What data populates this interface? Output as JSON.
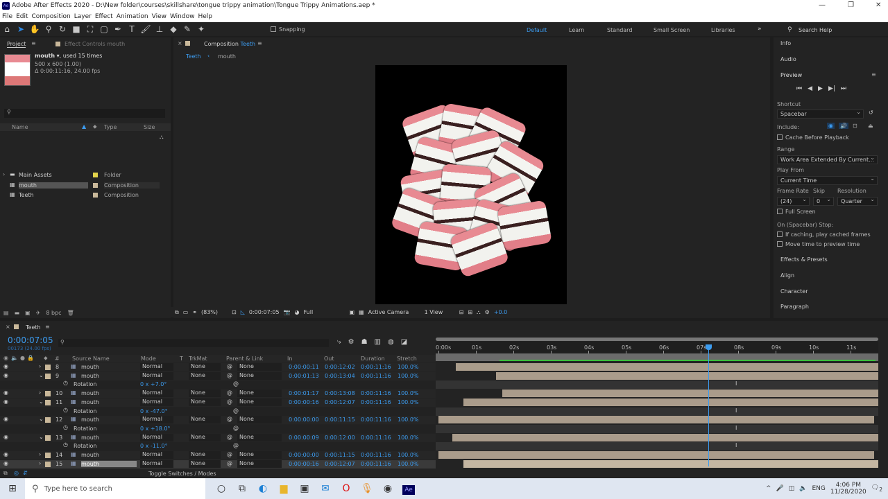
{
  "window": {
    "title": "Adobe After Effects 2020 - D:\\New folder\\courses\\skillshare\\tongue trippy animation\\Tongue Trippy Animations.aep *",
    "app_icon": "Ae"
  },
  "menu": [
    "File",
    "Edit",
    "Composition",
    "Layer",
    "Effect",
    "Animation",
    "View",
    "Window",
    "Help"
  ],
  "toolbar": {
    "snapping_label": "Snapping",
    "workspaces": [
      "Default",
      "Learn",
      "Standard",
      "Small Screen",
      "Libraries"
    ],
    "active_workspace": "Default",
    "search_placeholder": "Search Help"
  },
  "project": {
    "tab": "Project",
    "effect_controls_tab": "Effect Controls mouth",
    "item_name": "mouth",
    "item_used": ", used 15 times",
    "item_dims": "500 x 600 (1.00)",
    "item_duration": "Δ 0:00:11:16, 24.00 fps",
    "bpc": "8 bpc",
    "columns": [
      "Name",
      "Type",
      "Size"
    ],
    "items": [
      {
        "name": "Main Assets",
        "type": "Folder",
        "label_color": "#e3d34b",
        "icon": "folder-icon"
      },
      {
        "name": "mouth",
        "type": "Composition",
        "label_color": "#c9b89a",
        "icon": "composition-icon",
        "selected": true
      },
      {
        "name": "Teeth",
        "type": "Composition",
        "label_color": "#c9b89a",
        "icon": "composition-icon"
      }
    ]
  },
  "composition": {
    "tab_label": "Composition",
    "comp_name": "Teeth",
    "breadcrumb": [
      "Teeth",
      "mouth"
    ],
    "footer": {
      "zoom": "(83%)",
      "timecode": "0:00:07:05",
      "resolution": "Full",
      "camera": "Active Camera",
      "views": "1 View",
      "exposure": "+0.0"
    }
  },
  "preview": {
    "panels_top": [
      "Info",
      "Audio"
    ],
    "title": "Preview",
    "shortcut_label": "Shortcut",
    "shortcut": "Spacebar",
    "include_label": "Include:",
    "cache_label": "Cache Before Playback",
    "range_label": "Range",
    "range": "Work Area Extended By Current...",
    "play_from_label": "Play From",
    "play_from": "Current Time",
    "frame_rate_label": "Frame Rate",
    "frame_rate": "(24)",
    "skip_label": "Skip",
    "skip": "0",
    "resolution_label": "Resolution",
    "resolution": "Quarter",
    "full_screen_label": "Full Screen",
    "stop_label": "On (Spacebar) Stop:",
    "stop_opt1": "If caching, play cached frames",
    "stop_opt2": "Move time to preview time",
    "panels_bottom": [
      "Effects & Presets",
      "Align",
      "Character",
      "Paragraph"
    ]
  },
  "timeline": {
    "tab": "Teeth",
    "current_time": "0:00:07:05",
    "frame_info": "00173 (24.00 fps)",
    "toggle_label": "Toggle Switches / Modes",
    "accent": "#3c9cf0",
    "columns": [
      "Source Name",
      "Mode",
      "T",
      "TrkMat",
      "Parent & Link",
      "In",
      "Out",
      "Duration",
      "Stretch",
      "#"
    ],
    "ruler": [
      "0:00s",
      "01s",
      "02s",
      "03s",
      "04s",
      "05s",
      "06s",
      "07s",
      "08s",
      "09s",
      "10s",
      "11s"
    ],
    "current_seconds": 7.21,
    "rows": [
      {
        "kind": "layer",
        "num": "8",
        "name": "mouth",
        "mode": "Normal",
        "trkmat": "None",
        "parent": "None",
        "in": "0:00:00:11",
        "out": "0:00:12:02",
        "duration": "0:00:11:16",
        "stretch": "100.0%",
        "expanded": false
      },
      {
        "kind": "layer",
        "num": "9",
        "name": "mouth",
        "mode": "Normal",
        "trkmat": "None",
        "parent": "None",
        "in": "0:00:01:13",
        "out": "0:00:13:04",
        "duration": "0:00:11:16",
        "stretch": "100.0%",
        "expanded": true
      },
      {
        "kind": "property",
        "name": "Rotation",
        "value": "0 x +7.0°"
      },
      {
        "kind": "layer",
        "num": "10",
        "name": "mouth",
        "mode": "Normal",
        "trkmat": "None",
        "parent": "None",
        "in": "0:00:01:17",
        "out": "0:00:13:08",
        "duration": "0:00:11:16",
        "stretch": "100.0%",
        "expanded": false
      },
      {
        "kind": "layer",
        "num": "11",
        "name": "mouth",
        "mode": "Normal",
        "trkmat": "None",
        "parent": "None",
        "in": "0:00:00:16",
        "out": "0:00:12:07",
        "duration": "0:00:11:16",
        "stretch": "100.0%",
        "expanded": true
      },
      {
        "kind": "property",
        "name": "Rotation",
        "value": "0 x -47.0°"
      },
      {
        "kind": "layer",
        "num": "12",
        "name": "mouth",
        "mode": "Normal",
        "trkmat": "None",
        "parent": "None",
        "in": "0:00:00:00",
        "out": "0:00:11:15",
        "duration": "0:00:11:16",
        "stretch": "100.0%",
        "expanded": true
      },
      {
        "kind": "property",
        "name": "Rotation",
        "value": "0 x +18.0°"
      },
      {
        "kind": "layer",
        "num": "13",
        "name": "mouth",
        "mode": "Normal",
        "trkmat": "None",
        "parent": "None",
        "in": "0:00:00:09",
        "out": "0:00:12:00",
        "duration": "0:00:11:16",
        "stretch": "100.0%",
        "expanded": true
      },
      {
        "kind": "property",
        "name": "Rotation",
        "value": "0 x -11.0°"
      },
      {
        "kind": "layer",
        "num": "14",
        "name": "mouth",
        "mode": "Normal",
        "trkmat": "None",
        "parent": "None",
        "in": "0:00:00:00",
        "out": "0:00:11:15",
        "duration": "0:00:11:16",
        "stretch": "100.0%",
        "expanded": false
      },
      {
        "kind": "layer",
        "num": "15",
        "name": "mouth",
        "mode": "Normal",
        "trkmat": "None",
        "parent": "None",
        "in": "0:00:00:16",
        "out": "0:00:12:07",
        "duration": "0:00:11:16",
        "stretch": "100.0%",
        "expanded": false,
        "selected": true
      }
    ]
  },
  "taskbar": {
    "search_placeholder": "Type here to search",
    "language": "ENG",
    "time": "4:06 PM",
    "date": "11/28/2020",
    "notifications": "2"
  }
}
